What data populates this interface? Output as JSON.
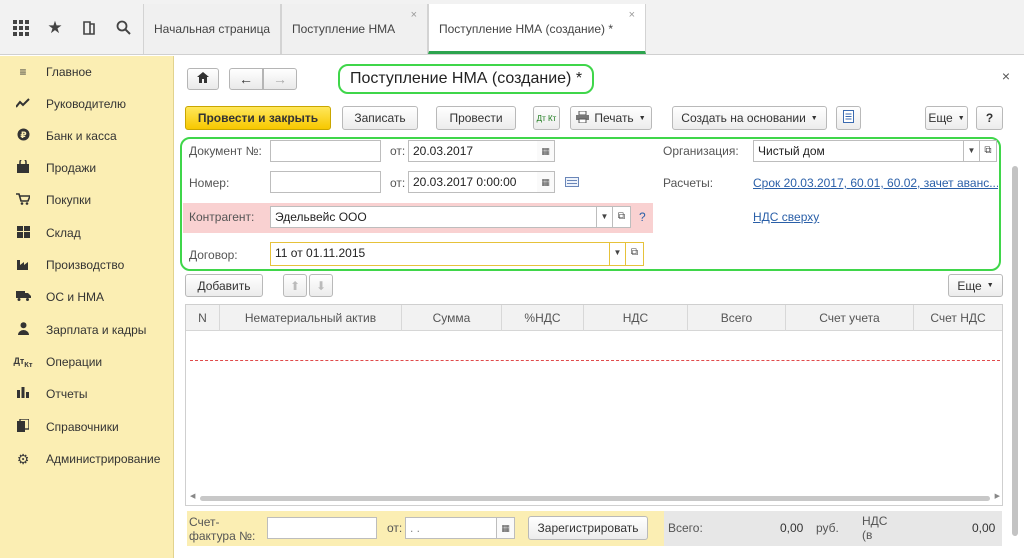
{
  "topbar": {
    "icons": [
      "apps-grid-icon",
      "star-icon",
      "history-icon",
      "search-icon"
    ],
    "tabs": [
      {
        "label": "Начальная страница"
      },
      {
        "label": "Поступление НМА",
        "close": "×"
      },
      {
        "label": "Поступление НМА (создание) *",
        "close": "×"
      }
    ]
  },
  "sidebar": {
    "items": [
      {
        "label": "Главное",
        "icon": "menu-lines-icon"
      },
      {
        "label": "Руководителю",
        "icon": "trend-chart-icon"
      },
      {
        "label": "Банк и касса",
        "icon": "ruble-coin-icon"
      },
      {
        "label": "Продажи",
        "icon": "shopping-bag-icon"
      },
      {
        "label": "Покупки",
        "icon": "cart-icon"
      },
      {
        "label": "Склад",
        "icon": "warehouse-grid-icon"
      },
      {
        "label": "Производство",
        "icon": "factory-icon"
      },
      {
        "label": "ОС и НМА",
        "icon": "truck-icon"
      },
      {
        "label": "Зарплата и кадры",
        "icon": "person-icon"
      },
      {
        "label": "Операции",
        "icon": "debit-credit-icon"
      },
      {
        "label": "Отчеты",
        "icon": "bar-chart-icon"
      },
      {
        "label": "Справочники",
        "icon": "books-icon"
      },
      {
        "label": "Администрирование",
        "icon": "gear-icon"
      }
    ]
  },
  "form": {
    "title": "Поступление НМА (создание) *",
    "close": "×",
    "toolbar": {
      "post_close": "Провести и закрыть",
      "save": "Записать",
      "post": "Провести",
      "dtkt": "Дт Кт",
      "print": "Печать",
      "create_based": "Создать на основании",
      "more": "Еще",
      "help": "?"
    },
    "fields": {
      "doc_no_label": "Документ №:",
      "doc_no_value": "",
      "doc_date_label": "от:",
      "doc_date_value": "20.03.2017",
      "number_label": "Номер:",
      "number_value": "",
      "number_date_label": "от:",
      "number_date_value": "20.03.2017  0:00:00",
      "org_label": "Организация:",
      "org_value": "Чистый дом",
      "settlements_label": "Расчеты:",
      "settlements_link": "Срок 20.03.2017, 60.01, 60.02, зачет аванс...",
      "contractor_label": "Контрагент:",
      "contractor_value": "Эдельвейс ООО",
      "contractor_help": "?",
      "vat_link": "НДС сверху",
      "contract_label": "Договор:",
      "contract_value": "11 от 01.11.2015"
    },
    "table_toolbar": {
      "add": "Добавить",
      "more": "Еще"
    },
    "table": {
      "columns": [
        "N",
        "Нематериальный актив",
        "Сумма",
        "%НДС",
        "НДС",
        "Всего",
        "Счет учета",
        "Счет НДС"
      ],
      "rows": []
    },
    "footer": {
      "invoice_label": "Счет-фактура №:",
      "invoice_value": "",
      "invoice_date_label": "от:",
      "invoice_date_value": ". .",
      "register": "Зарегистрировать",
      "total_label": "Всего:",
      "total_value": "0,00",
      "currency": "руб.",
      "vat_label": "НДС (в",
      "vat_value": "0,00"
    }
  }
}
